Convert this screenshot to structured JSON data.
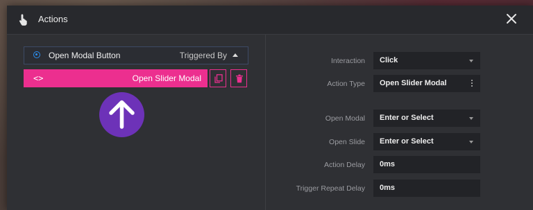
{
  "header": {
    "title": "Actions"
  },
  "trigger": {
    "name": "Open Modal Button",
    "triggered_by": "Triggered By"
  },
  "action": {
    "code_symbol": "<>",
    "label": "Open Slider Modal"
  },
  "fields": [
    {
      "label": "Interaction",
      "value": "Click"
    },
    {
      "label": "Action Type",
      "value": "Open Slider Modal"
    },
    {
      "label": "Open Modal",
      "value": "Enter or Select"
    },
    {
      "label": "Open Slide",
      "value": "Enter or Select"
    },
    {
      "label": "Action Delay",
      "value": "0ms"
    },
    {
      "label": "Trigger Repeat Delay",
      "value": "0ms"
    }
  ],
  "colors": {
    "accent_pink": "#ec2f8f",
    "radio_blue": "#2b8ef0",
    "arrow_purple": "#6d32b8"
  },
  "icons": [
    "hand-pointer-icon",
    "close-icon",
    "radio-icon",
    "caret-up-icon",
    "code-icon",
    "copy-icon",
    "trash-icon",
    "arrow-up-icon",
    "dropdown-icon",
    "kebab-icon"
  ]
}
